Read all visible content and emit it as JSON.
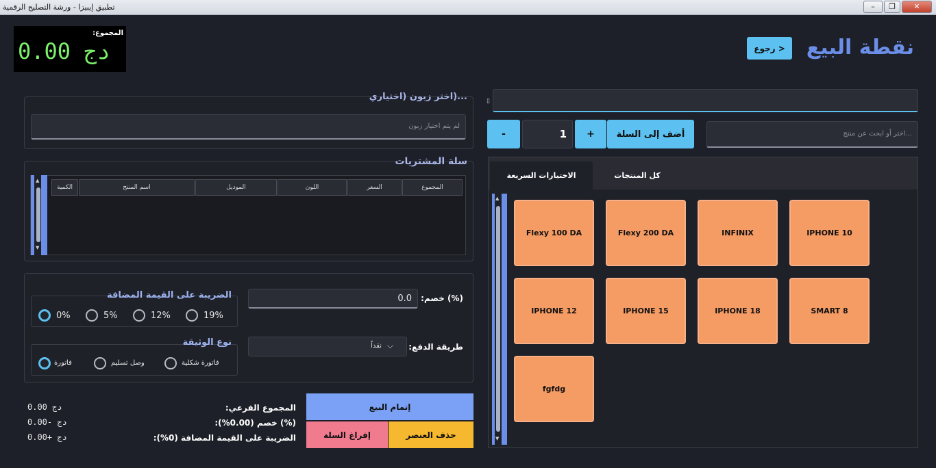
{
  "window": {
    "title": "تطبيق إيبيزا - ورشة التصليح الرقمية",
    "minimize": "–",
    "maximize": "❐",
    "close": "✕"
  },
  "total": {
    "label": "المجموع:",
    "value": "0.00  دج"
  },
  "header": {
    "title": "نقطة البيع",
    "back_label": "< رجوع"
  },
  "customer": {
    "legend": "...(اختر زبون (اختياري",
    "placeholder": "لم يتم اختيار زبون"
  },
  "cart": {
    "legend": "سلة المشتريات",
    "columns": [
      "الكمية",
      "اسم المنتج",
      "الموديل",
      "اللون",
      "السعر",
      "المجموع"
    ]
  },
  "discount": {
    "label": "(%) خصم:",
    "value": "0.0"
  },
  "vat": {
    "legend": "الضريبة على القيمة المضافة",
    "options": [
      "0%",
      "5%",
      "12%",
      "19%"
    ],
    "selected": "0%"
  },
  "payment": {
    "label": "طريقة الدفع:",
    "value": "نقداً"
  },
  "document": {
    "legend": "نوع الوثيقة",
    "options": [
      "فاتورة",
      "وصل تسليم",
      "فاتورة شكلية"
    ],
    "selected": "فاتورة"
  },
  "summary": {
    "subtotal_label": "المجموع الفرعي:",
    "subtotal_value": "دج  0.00",
    "discount_label": "(%) خصم (0.00%):",
    "discount_value": "دج  -0.00",
    "vat_label": "الضريبة على القيمة المضافة (0%):",
    "vat_value": "دج  +0.00"
  },
  "actions": {
    "complete": "إتمام البيع",
    "empty": "إفراغ السلة",
    "delete": "حذف العنصر"
  },
  "product_search": {
    "placeholder": "...اختر أو ابحث عن منتج"
  },
  "add_to_cart": {
    "label": "أضف إلى السلة",
    "plus": "+",
    "minus": "-",
    "quantity": "1"
  },
  "tabs": {
    "quick": "الاختيارات السريعة",
    "all": "كل المنتجات"
  },
  "products": [
    "IPHONE 10",
    "INFINIX",
    "Flexy 200 DA",
    "Flexy 100 DA",
    "SMART 8",
    "IPHONE 18",
    "IPHONE 15",
    "IPHONE 12",
    "fgfdg"
  ],
  "colors": {
    "accent": "#6b8fe8",
    "tile": "#f59b64",
    "button_blue": "#5cc0f0",
    "complete": "#7aa1f5",
    "empty": "#f07b8f",
    "delete": "#f5b82e"
  }
}
